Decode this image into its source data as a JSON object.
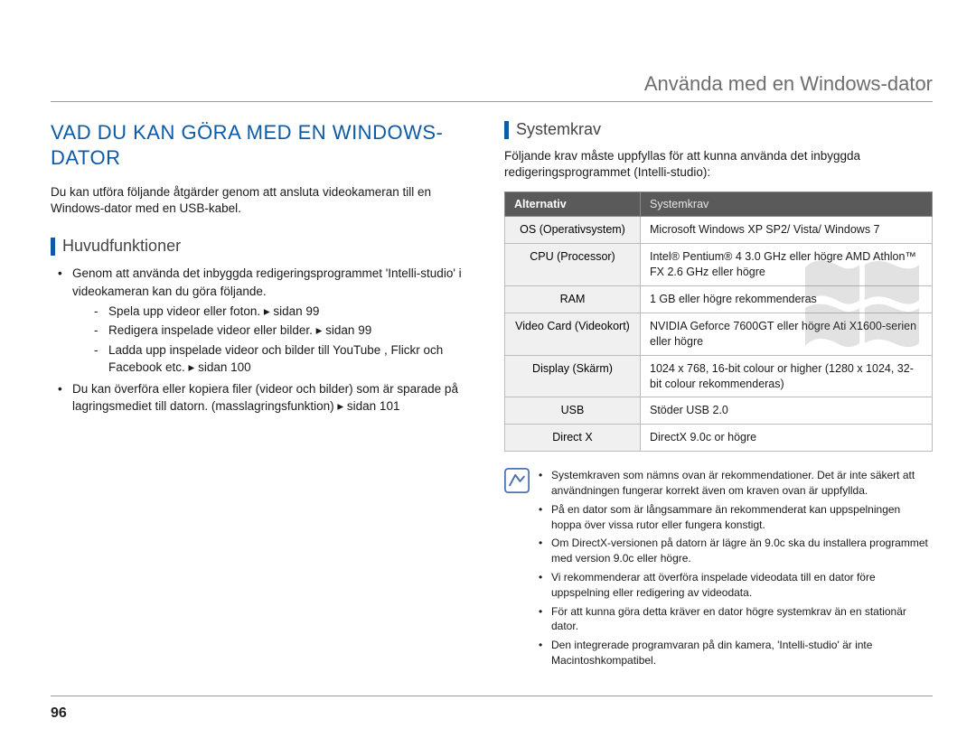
{
  "chapter": "Använda med en Windows-dator",
  "page_number": "96",
  "left": {
    "title": "VAD DU KAN GÖRA MED EN WINDOWS-DATOR",
    "intro": "Du kan utföra följande åtgärder genom att ansluta videokameran till en Windows-dator med en USB-kabel.",
    "subhead": "Huvudfunktioner",
    "b1_lead": "Genom att använda det inbyggda redigeringsprogrammet 'Intelli-studio' i videokameran kan du göra följande.",
    "d1": "Spela upp videor eller foton. ▸ sidan 99",
    "d2": "Redigera inspelade videor eller bilder. ▸ sidan 99",
    "d3": "Ladda upp inspelade videor och bilder till YouTube , Flickr och Facebook etc. ▸ sidan 100",
    "b2": "Du kan överföra eller kopiera filer (videor och bilder) som är sparade på lagringsmediet till datorn. (masslagringsfunktion) ▸ sidan 101"
  },
  "right": {
    "subhead": "Systemkrav",
    "intro": "Följande krav måste uppfyllas för att kunna använda det inbyggda redigeringsprogrammet (Intelli-studio):",
    "table": {
      "th_alt": "Alternativ",
      "th_req": "Systemkrav",
      "rows": [
        {
          "alt": "OS (Operativsystem)",
          "val": "Microsoft Windows XP SP2/ Vista/ Windows 7"
        },
        {
          "alt": "CPU (Processor)",
          "val": "Intel® Pentium® 4 3.0 GHz eller högre AMD Athlon™ FX 2.6 GHz eller högre"
        },
        {
          "alt": "RAM",
          "val": "1 GB eller högre rekommenderas"
        },
        {
          "alt": "Video Card (Videokort)",
          "val": "NVIDIA Geforce 7600GT eller högre Ati X1600-serien eller högre"
        },
        {
          "alt": "Display (Skärm)",
          "val": "1024 x 768, 16-bit colour or higher (1280 x 1024, 32-bit colour rekommenderas)"
        },
        {
          "alt": "USB",
          "val": "Stöder USB 2.0"
        },
        {
          "alt": "Direct X",
          "val": "DirectX 9.0c or högre"
        }
      ]
    },
    "notes": [
      "Systemkraven som nämns ovan är rekommendationer. Det är inte säkert att användningen fungerar korrekt även om kraven ovan är uppfyllda.",
      "På en dator som är långsammare än rekommenderat kan uppspelningen hoppa över vissa rutor eller fungera konstigt.",
      "Om DirectX-versionen på datorn är lägre än 9.0c ska du installera programmet med version 9.0c eller högre.",
      "Vi rekommenderar att överföra inspelade videodata till en dator före uppspelning eller redigering av videodata.",
      "För att kunna göra detta kräver en dator högre systemkrav än en stationär dator.",
      "Den integrerade programvaran på din kamera, 'Intelli-studio' är inte Macintoshkompatibel."
    ]
  }
}
